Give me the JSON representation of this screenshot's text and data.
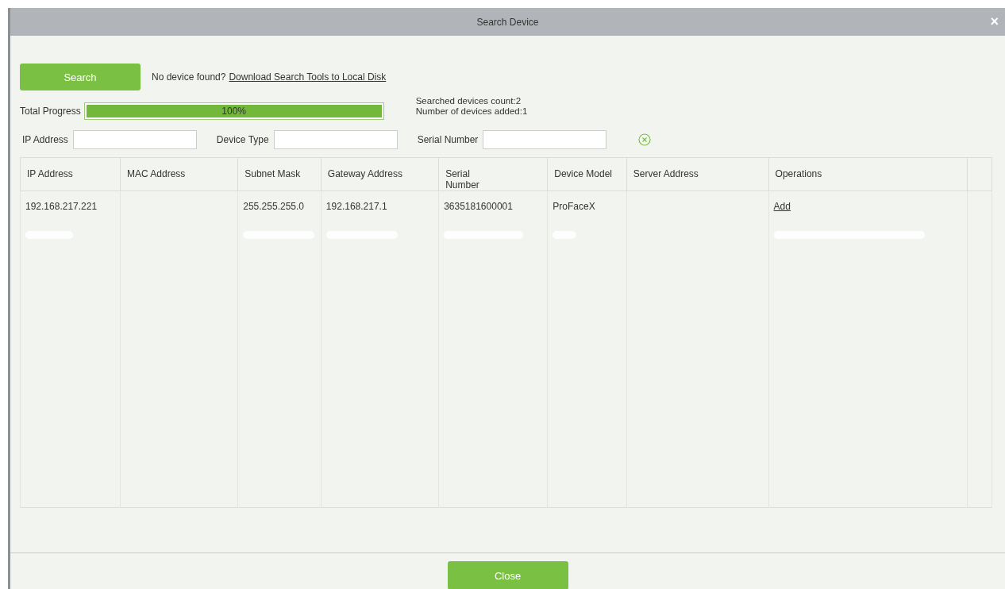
{
  "window": {
    "title": "Search Device",
    "close_glyph": "×"
  },
  "search_button": "Search",
  "hint": {
    "text": "No device found?",
    "link": "Download Search Tools to Local Disk"
  },
  "progress": {
    "label": "Total Progress",
    "level": 1,
    "reading": "100%"
  },
  "stats": [
    "Searched devices count:2",
    "Number of devices added:1"
  ],
  "filters": [
    {
      "label": "IP Address"
    },
    {
      "label": "Device Type"
    },
    {
      "label": "Serial Number"
    }
  ],
  "table": {
    "columns": [
      "IP Address",
      "MAC Address",
      "Subnet Mask",
      "Gateway Address",
      "Serial Number",
      "Device Model",
      "Server Address",
      "Operations"
    ],
    "rows": [
      {
        "cells": [
          "192.168.217.221",
          "",
          "255.255.255.0",
          "192.168.217.1",
          "3635181600001",
          "ProFaceX",
          ""
        ],
        "operation": "Add"
      }
    ]
  },
  "footer_button": "Close"
}
